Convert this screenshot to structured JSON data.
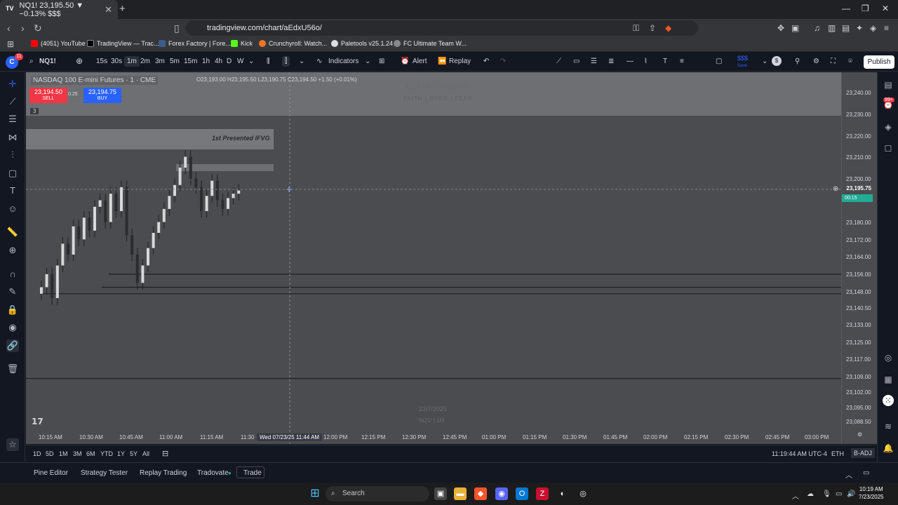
{
  "browser": {
    "tab_title": "NQ1! 23,195.50 ▼ −0.13% $$$",
    "url": "tradingview.com/chart/aEdxU56o/",
    "bookmarks": [
      "(4051) YouTube",
      "TradingView — Trac...",
      "Forex Factory | Fore...",
      "Kick",
      "Crunchyroll: Watch...",
      "Paletools v25.1.24",
      "FC Ultimate Team W..."
    ]
  },
  "toolbar": {
    "avatar_badge": "11",
    "symbol": "NQ1!",
    "intervals": [
      "15s",
      "30s",
      "1m",
      "2m",
      "3m",
      "5m",
      "15m",
      "1h",
      "4h",
      "D",
      "W"
    ],
    "active_interval": "1m",
    "indicators": "Indicators",
    "alert": "Alert",
    "replay": "Replay",
    "save_label": "Save",
    "save_money": "$$$",
    "publish": "Publish"
  },
  "legend": {
    "title": "NASDAQ 100 E-mini Futures · 1 · CME",
    "ohlc": "O23,193.00 H23,195.50 L23,190.75 C23,194.50 +1.50 (+0.01%)",
    "sell_price": "23,194.50",
    "sell_label": "SELL",
    "spread": "0.25",
    "buy_price": "23,194.75",
    "buy_label": "BUY",
    "indicator_count": "3"
  },
  "watermark": {
    "title": "CLOS TRADES",
    "subtitle": "FAITH | OVER | FEAR",
    "date": "23/7/2025",
    "symbol_tf": "NQ1! | 1M"
  },
  "drawing": {
    "ifvg_label": "1st Presented IFVG"
  },
  "price_scale": {
    "labels": [
      "23,240.00",
      "23,230.00",
      "23,220.00",
      "23,210.00",
      "23,200.00",
      "23,180.00",
      "23,172.00",
      "23,164.00",
      "23,156.00",
      "23,148.00",
      "23,140.50",
      "23,133.00",
      "23,125.00",
      "23,117.00",
      "23,109.00",
      "23,102.00",
      "23,095.00",
      "23,088.50"
    ],
    "current_price": "23,195.75",
    "countdown": "00:15"
  },
  "time_scale": {
    "labels": [
      "10:15 AM",
      "10:30 AM",
      "10:45 AM",
      "11:00 AM",
      "11:15 AM",
      "11:30",
      "12:00 PM",
      "12:15 PM",
      "12:30 PM",
      "12:45 PM",
      "01:00 PM",
      "01:15 PM",
      "01:30 PM",
      "01:45 PM",
      "02:00 PM",
      "02:15 PM",
      "02:30 PM",
      "02:45 PM",
      "03:00 PM"
    ],
    "crosshair_label": "Wed 07/23/25   11:44 AM"
  },
  "range_bar": {
    "ranges": [
      "1D",
      "5D",
      "1M",
      "3M",
      "6M",
      "YTD",
      "1Y",
      "5Y",
      "All"
    ],
    "clock": "11:19:44 AM UTC-4",
    "session": "ETH",
    "adjust": "B-ADJ"
  },
  "bottom_panel": {
    "tabs": [
      "Pine Editor",
      "Strategy Tester",
      "Replay Trading",
      "Tradovate",
      "Trade"
    ]
  },
  "taskbar": {
    "search": "Search",
    "time": "10:19 AM",
    "date": "7/23/2025"
  },
  "right_badge": "99+",
  "chart_data": {
    "type": "candlestick",
    "ylim": [
      23085,
      23245
    ],
    "series": [
      {
        "t": 0,
        "c": 23150
      },
      {
        "t": 1,
        "c": 23156
      },
      {
        "t": 2,
        "c": 23145
      },
      {
        "t": 3,
        "c": 23160
      },
      {
        "t": 4,
        "c": 23170
      },
      {
        "t": 5,
        "c": 23165
      },
      {
        "t": 6,
        "c": 23178
      },
      {
        "t": 7,
        "c": 23172
      },
      {
        "t": 8,
        "c": 23182
      },
      {
        "t": 9,
        "c": 23176
      },
      {
        "t": 10,
        "c": 23187
      },
      {
        "t": 11,
        "c": 23190
      },
      {
        "t": 12,
        "c": 23180
      },
      {
        "t": 13,
        "c": 23193
      },
      {
        "t": 14,
        "c": 23185
      },
      {
        "t": 15,
        "c": 23196
      },
      {
        "t": 16,
        "c": 23174
      },
      {
        "t": 17,
        "c": 23165
      },
      {
        "t": 18,
        "c": 23152
      },
      {
        "t": 19,
        "c": 23160
      },
      {
        "t": 20,
        "c": 23168
      },
      {
        "t": 21,
        "c": 23175
      },
      {
        "t": 22,
        "c": 23180
      },
      {
        "t": 23,
        "c": 23186
      },
      {
        "t": 24,
        "c": 23192
      },
      {
        "t": 25,
        "c": 23197
      },
      {
        "t": 26,
        "c": 23205
      },
      {
        "t": 27,
        "c": 23210
      },
      {
        "t": 28,
        "c": 23200
      },
      {
        "t": 29,
        "c": 23196
      },
      {
        "t": 30,
        "c": 23185
      },
      {
        "t": 31,
        "c": 23192
      },
      {
        "t": 32,
        "c": 23199
      },
      {
        "t": 33,
        "c": 23190
      },
      {
        "t": 34,
        "c": 23186
      },
      {
        "t": 35,
        "c": 23191
      },
      {
        "t": 36,
        "c": 23193
      },
      {
        "t": 37,
        "c": 23194.5
      }
    ],
    "levels": [
      23156,
      23150,
      23147,
      23108
    ]
  }
}
